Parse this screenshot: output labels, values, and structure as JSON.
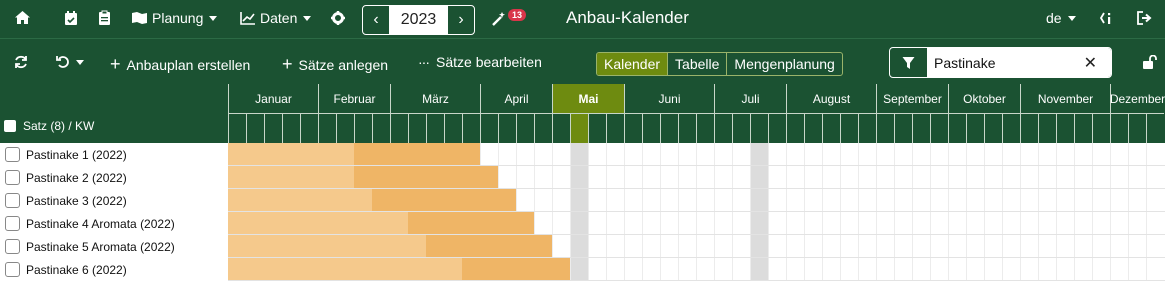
{
  "topbar": {
    "home_icon": "home-icon",
    "calendar_icon": "calendar-check-icon",
    "clipboard_icon": "clipboard-icon",
    "planung_label": "Planung",
    "daten_label": "Daten",
    "year": "2023",
    "notif_count": "13",
    "title": "Anbau-Kalender",
    "lang": "de"
  },
  "toolbar": {
    "anbauplan_label": "Anbauplan erstellen",
    "saetze_anlegen_label": "Sätze anlegen",
    "saetze_bearbeiten_label": "Sätze bearbeiten",
    "views": [
      "Kalender",
      "Tabelle",
      "Mengenplanung"
    ],
    "active_view": "Kalender",
    "filter_value": "Pastinake"
  },
  "header": {
    "label": "Satz (8) / KW",
    "months": [
      "Januar",
      "Februar",
      "März",
      "April",
      "Mai",
      "Juni",
      "Juli",
      "August",
      "September",
      "Oktober",
      "November",
      "Dezember"
    ],
    "current_month": "Mai"
  },
  "rows": [
    {
      "label": "Pastinake 1 (2022)",
      "light_from": 0,
      "light_to": 7,
      "dark_to": 14
    },
    {
      "label": "Pastinake 2 (2022)",
      "light_from": 0,
      "light_to": 7,
      "dark_to": 15
    },
    {
      "label": "Pastinake 3 (2022)",
      "light_from": 0,
      "light_to": 8,
      "dark_to": 16
    },
    {
      "label": "Pastinake 4 Aromata (2022)",
      "light_from": 0,
      "light_to": 10,
      "dark_to": 17
    },
    {
      "label": "Pastinake 5 Aromata (2022)",
      "light_from": 0,
      "light_to": 11,
      "dark_to": 18
    },
    {
      "label": "Pastinake 6 (2022)",
      "light_from": 0,
      "light_to": 13,
      "dark_to": 19
    }
  ],
  "colors": {
    "header_bg": "#1b5232",
    "active_green": "#6e8b10",
    "bar_light": "#f5c98c",
    "bar_dark": "#efb566"
  }
}
